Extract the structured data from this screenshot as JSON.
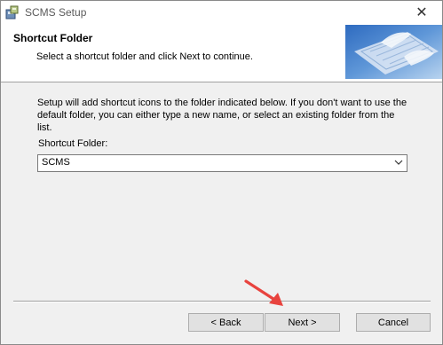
{
  "window": {
    "title": "SCMS Setup",
    "close_symbol": "✕"
  },
  "header": {
    "title": "Shortcut Folder",
    "subtitle": "Select a shortcut folder and click Next to continue."
  },
  "content": {
    "description": "Setup will add shortcut icons to the folder indicated below. If you don't want to use the default folder, you can either type a new name, or select an existing folder from the list.",
    "folder_label": "Shortcut Folder:",
    "folder_value": "SCMS"
  },
  "buttons": {
    "back": "< Back",
    "next": "Next >",
    "cancel": "Cancel"
  },
  "colors": {
    "annotation_arrow": "#e8433e",
    "header_image": "#3f78c4"
  },
  "icons": [
    "setup-app-icon",
    "close-icon",
    "keyboard-hands-image",
    "chevron-down-icon",
    "annotation-arrow"
  ]
}
